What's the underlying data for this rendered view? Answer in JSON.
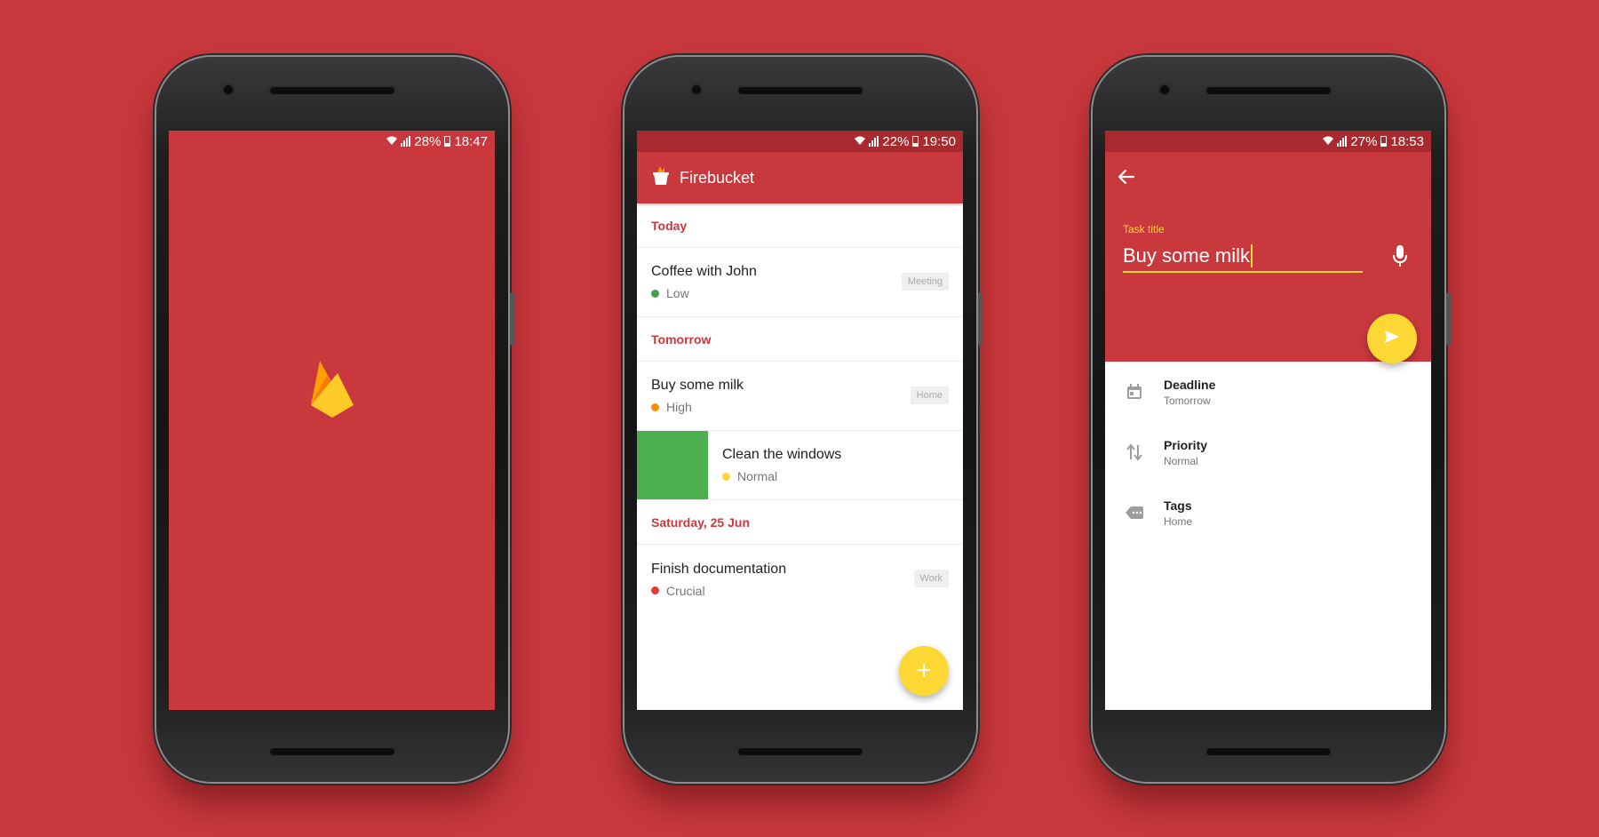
{
  "colors": {
    "brand_red": "#c9383d",
    "dark_red": "#a82a2f",
    "accent_yellow": "#fdd835",
    "swipe_green": "#4caf50"
  },
  "phone1": {
    "status": {
      "battery": "28%",
      "time": "18:47"
    },
    "logo": "firebase-flame-logo"
  },
  "phone2": {
    "status": {
      "battery": "22%",
      "time": "19:50"
    },
    "app_title": "Firebucket",
    "sections": [
      {
        "label": "Today"
      },
      {
        "label": "Tomorrow"
      },
      {
        "label": "Saturday, 25 Jun"
      }
    ],
    "tasks": [
      {
        "title": "Coffee with John",
        "priority": "Low",
        "priority_color": "#43a047",
        "tag": "Meeting"
      },
      {
        "title": "Buy some milk",
        "priority": "High",
        "priority_color": "#fb8c00",
        "tag": "Home"
      },
      {
        "title": "Clean the windows",
        "priority": "Normal",
        "priority_color": "#fdd835",
        "tag": ""
      },
      {
        "title": "Finish documentation",
        "priority": "Crucial",
        "priority_color": "#e53935",
        "tag": "Work"
      }
    ],
    "fab": "+"
  },
  "phone3": {
    "status": {
      "battery": "27%",
      "time": "18:53"
    },
    "field_label": "Task title",
    "field_value": "Buy some milk",
    "properties": [
      {
        "name": "Deadline",
        "value": "Tomorrow",
        "icon": "calendar-icon"
      },
      {
        "name": "Priority",
        "value": "Normal",
        "icon": "sort-arrows-icon"
      },
      {
        "name": "Tags",
        "value": "Home",
        "icon": "label-icon"
      }
    ]
  }
}
